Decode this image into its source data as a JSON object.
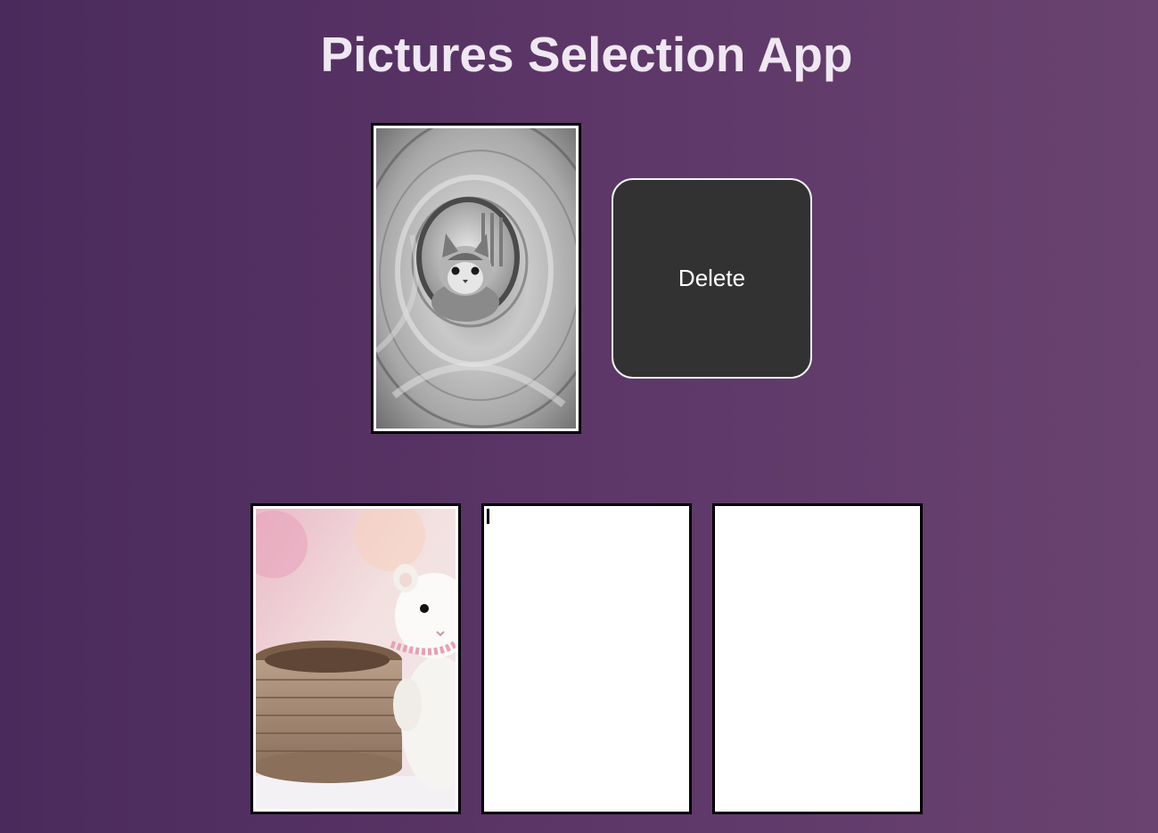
{
  "app": {
    "title": "Pictures Selection App"
  },
  "selected": {
    "image_subject": "grayscale kitten peeking through a play tunnel"
  },
  "actions": {
    "delete_label": "Delete"
  },
  "gallery": {
    "items": [
      {
        "subject": "white felt kitten toy beside a woven basket",
        "filled": true
      },
      {
        "subject": "",
        "filled": false
      },
      {
        "subject": "",
        "filled": false
      }
    ]
  },
  "colors": {
    "background_start": "#4a2a5c",
    "background_end": "#6a4370",
    "title_text": "#efe7f1",
    "button_bg": "#323232",
    "button_border": "#f2f2f2",
    "frame_border": "#000000"
  }
}
